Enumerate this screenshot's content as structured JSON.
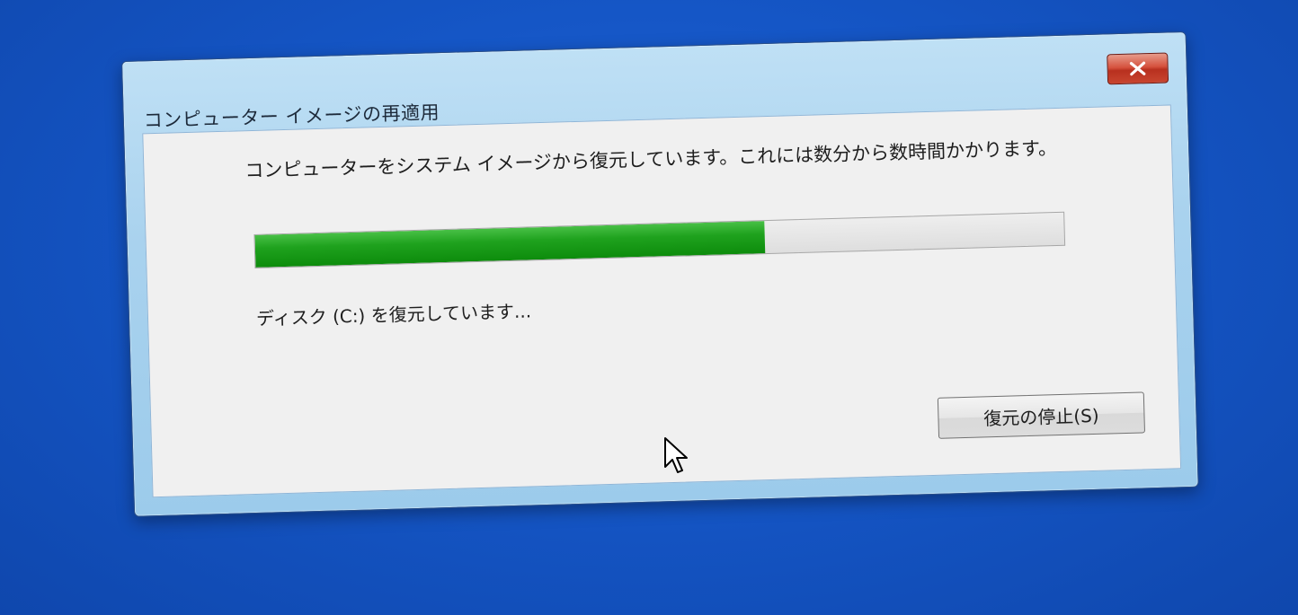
{
  "window": {
    "title": "コンピューター イメージの再適用",
    "close_icon": "close-icon"
  },
  "content": {
    "message": "コンピューターをシステム イメージから復元しています。これには数分から数時間かかります。",
    "progress_fraction": 0.63,
    "status": "ディスク (C:) を復元しています..."
  },
  "buttons": {
    "stop_label": "復元の停止(S)"
  },
  "colors": {
    "desktop": "#1556c6",
    "progress_green": "#1fa21e",
    "close_red": "#c8452f"
  },
  "pointer_icon": "mouse-pointer-icon"
}
